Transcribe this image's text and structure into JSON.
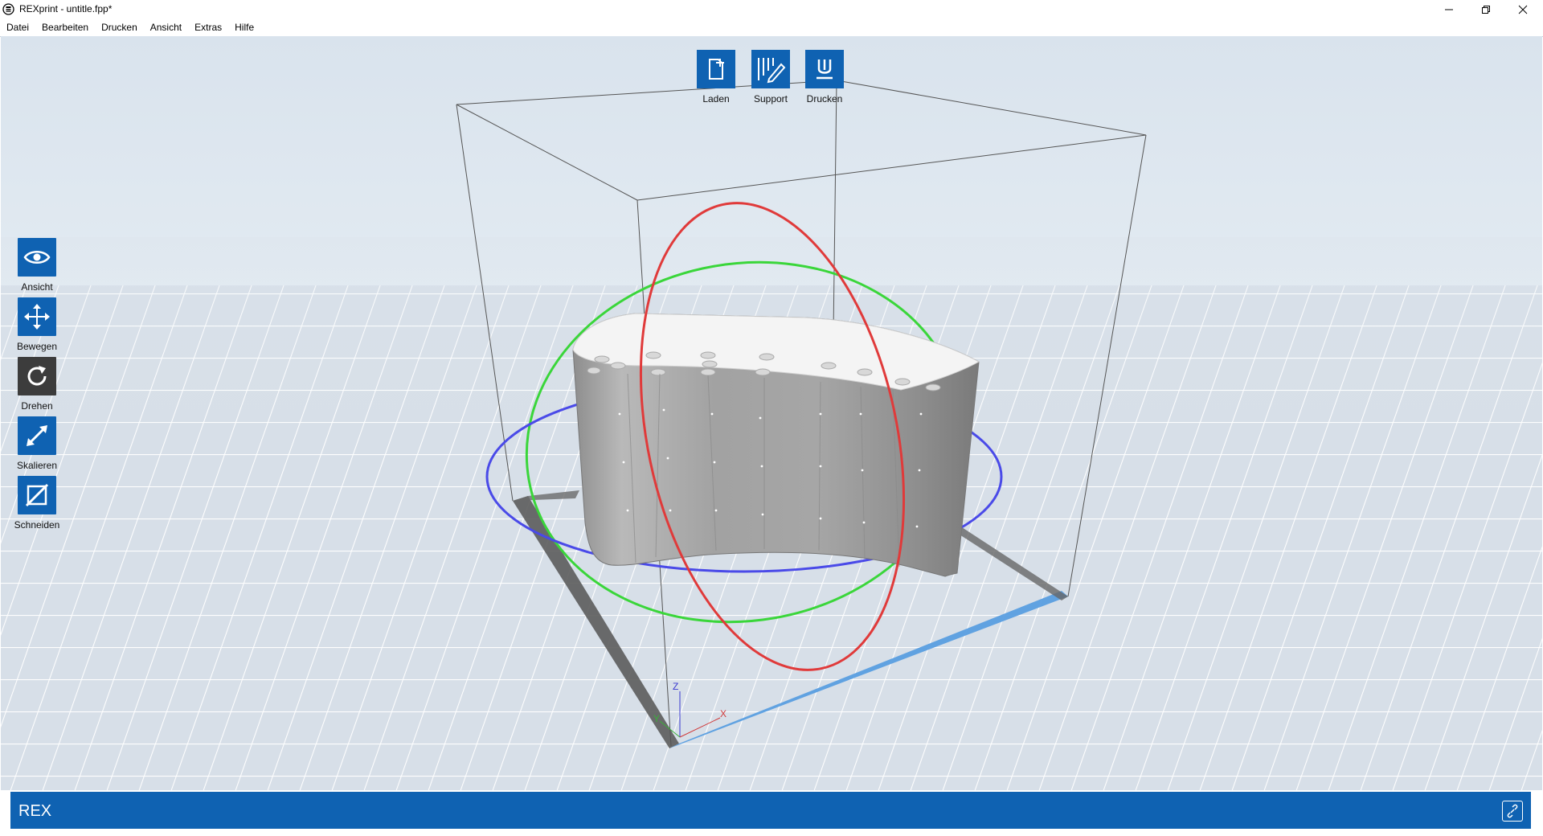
{
  "window": {
    "title": "REXprint - untitle.fpp*",
    "controls": [
      "minimize-icon",
      "restore-icon",
      "close-icon"
    ]
  },
  "menu": [
    {
      "label": "Datei"
    },
    {
      "label": "Bearbeiten"
    },
    {
      "label": "Drucken"
    },
    {
      "label": "Ansicht"
    },
    {
      "label": "Extras"
    },
    {
      "label": "Hilfe"
    }
  ],
  "top_toolbar": [
    {
      "label": "Laden",
      "icon": "file-plus-icon"
    },
    {
      "label": "Support",
      "icon": "support-edit-icon"
    },
    {
      "label": "Drucken",
      "icon": "print-nozzle-icon"
    }
  ],
  "side_toolbar": [
    {
      "label": "Ansicht",
      "icon": "eye-icon",
      "active": false
    },
    {
      "label": "Bewegen",
      "icon": "move-arrows-icon",
      "active": false
    },
    {
      "label": "Drehen",
      "icon": "rotate-icon",
      "active": true
    },
    {
      "label": "Skalieren",
      "icon": "scale-diagonal-icon",
      "active": false
    },
    {
      "label": "Schneiden",
      "icon": "cut-icon",
      "active": false
    }
  ],
  "axes": {
    "x": "X",
    "y": "Y",
    "z": "Z"
  },
  "status": {
    "brand": "REX",
    "link_icon": "link-icon"
  },
  "colors": {
    "accent": "#0f62b2",
    "active_tool": "#3c3c3c",
    "ring_x": "#e03a3a",
    "ring_y": "#3ad63a",
    "ring_z": "#4a4ae8",
    "plate_edge": "#5a9ee0"
  }
}
